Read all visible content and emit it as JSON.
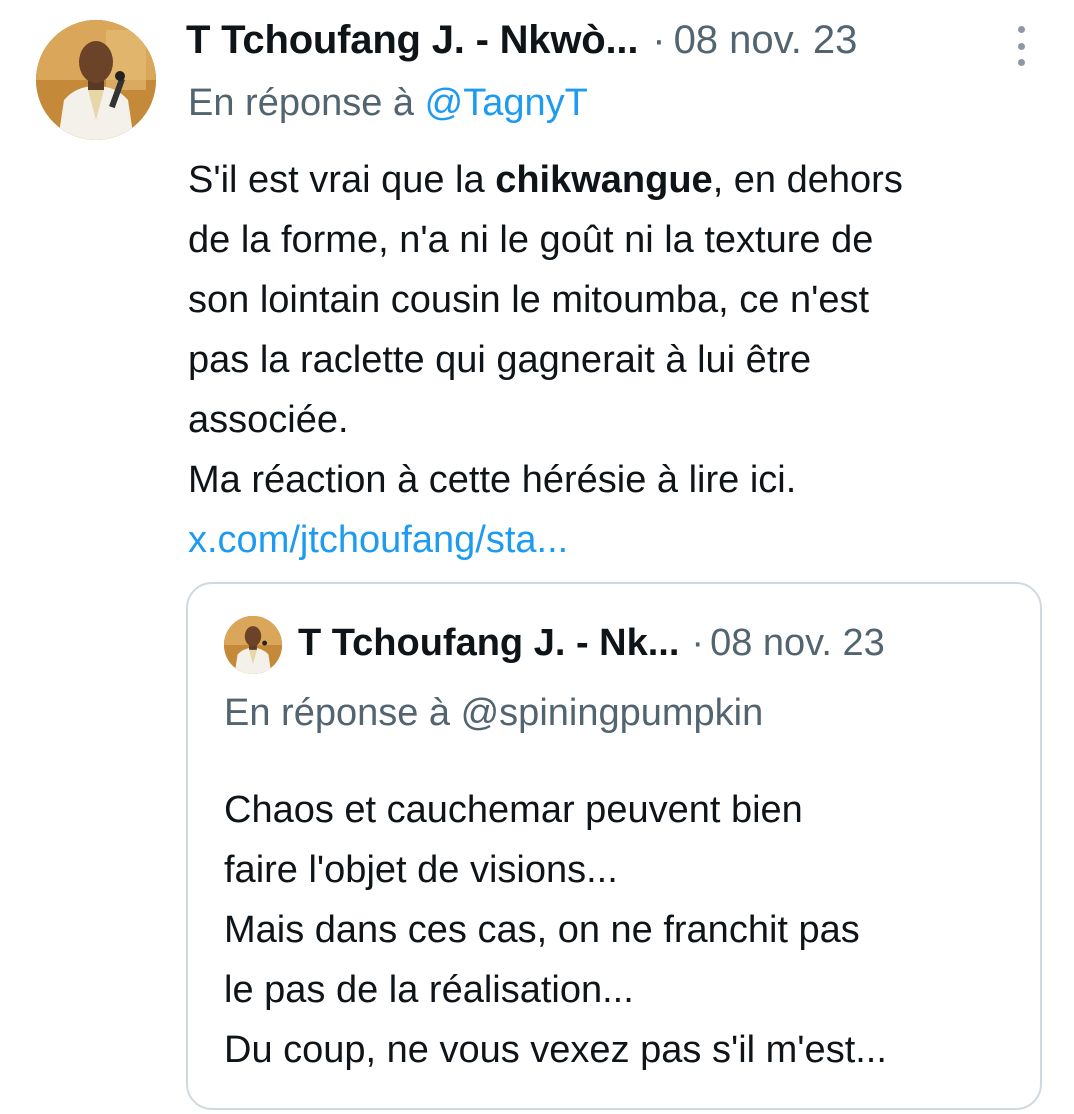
{
  "tweet": {
    "author": "T Tchoufang J. - Nkwò...",
    "separator": "·",
    "date": "08 nov. 23",
    "more_icon": "more-vertical-icon",
    "reply_prefix": "En réponse à",
    "reply_handle": "@TagnyT",
    "body": {
      "l1_a": "S'il est vrai que la ",
      "l1_bold": "chikwangue",
      "l1_b": ", en dehors",
      "l2": "de la forme, n'a ni le goût ni la texture de",
      "l3": "son lointain cousin le mitoumba, ce n'est",
      "l4": "pas la raclette qui gagnerait à lui être",
      "l5": "associée.",
      "l6": "Ma réaction à cette hérésie à lire ici.",
      "link": "x.com/jtchoufang/sta..."
    }
  },
  "quoted": {
    "author": "T Tchoufang J. - Nk...",
    "separator": "·",
    "date": "08 nov. 23",
    "reply_text": "En réponse à @spiningpumpkin",
    "lines": [
      "Chaos et cauchemar peuvent bien",
      "faire l'objet de visions...",
      "Mais dans ces cas, on ne franchit pas",
      "le pas de la réalisation...",
      "Du coup, ne vous vexez pas s'il m'est..."
    ]
  },
  "colors": {
    "text": "#0f1419",
    "secondary": "#536471",
    "link": "#1d9bf0",
    "border": "#cfd9de"
  }
}
